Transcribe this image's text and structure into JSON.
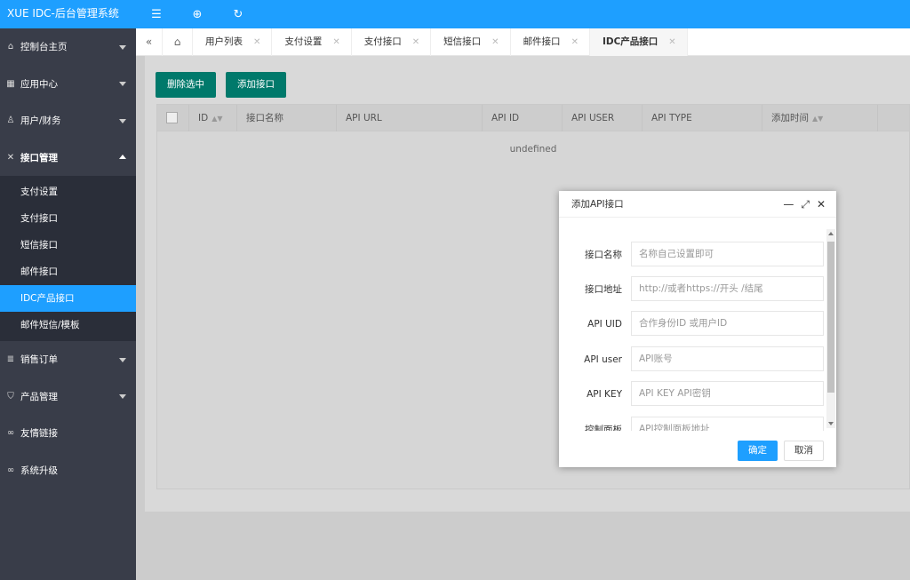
{
  "app": {
    "title": "XUE IDC-后台管理系统"
  },
  "sidebar": {
    "items": [
      {
        "label": "控制台主页",
        "icon": "home-icon"
      },
      {
        "label": "应用中心",
        "icon": "apps-icon"
      },
      {
        "label": "用户/财务",
        "icon": "user-icon"
      },
      {
        "label": "接口管理",
        "icon": "tools-icon"
      },
      {
        "label": "销售订单",
        "icon": "list-icon"
      },
      {
        "label": "产品管理",
        "icon": "shield-icon"
      },
      {
        "label": "友情链接",
        "icon": "link-icon"
      },
      {
        "label": "系统升级",
        "icon": "link-icon"
      }
    ],
    "submenu": [
      "支付设置",
      "支付接口",
      "短信接口",
      "邮件接口",
      "IDC产品接口",
      "邮件短信/模板"
    ]
  },
  "tabs": [
    "用户列表",
    "支付设置",
    "支付接口",
    "短信接口",
    "邮件接口",
    "IDC产品接口"
  ],
  "toolbar": {
    "delete_label": "删除选中",
    "add_label": "添加接口"
  },
  "table": {
    "columns": [
      "ID",
      "接口名称",
      "API URL",
      "API ID",
      "API USER",
      "API TYPE",
      "添加时间"
    ],
    "empty_text": "undefined"
  },
  "modal": {
    "title": "添加API接口",
    "fields": [
      {
        "label": "接口名称",
        "placeholder": "名称自己设置即可"
      },
      {
        "label": "接口地址",
        "placeholder": "http://或者https://开头 /结尾"
      },
      {
        "label": "API UID",
        "placeholder": "合作身份ID 或用户ID"
      },
      {
        "label": "API user",
        "placeholder": "API账号"
      },
      {
        "label": "API KEY",
        "placeholder": "API KEY  API密钥"
      },
      {
        "label": "控制面板",
        "placeholder": "API控制面板地址"
      }
    ],
    "confirm_label": "确定",
    "cancel_label": "取消"
  },
  "colors": {
    "primary": "#1e9fff",
    "sidebar": "#393d49",
    "button_green": "#00796b"
  }
}
